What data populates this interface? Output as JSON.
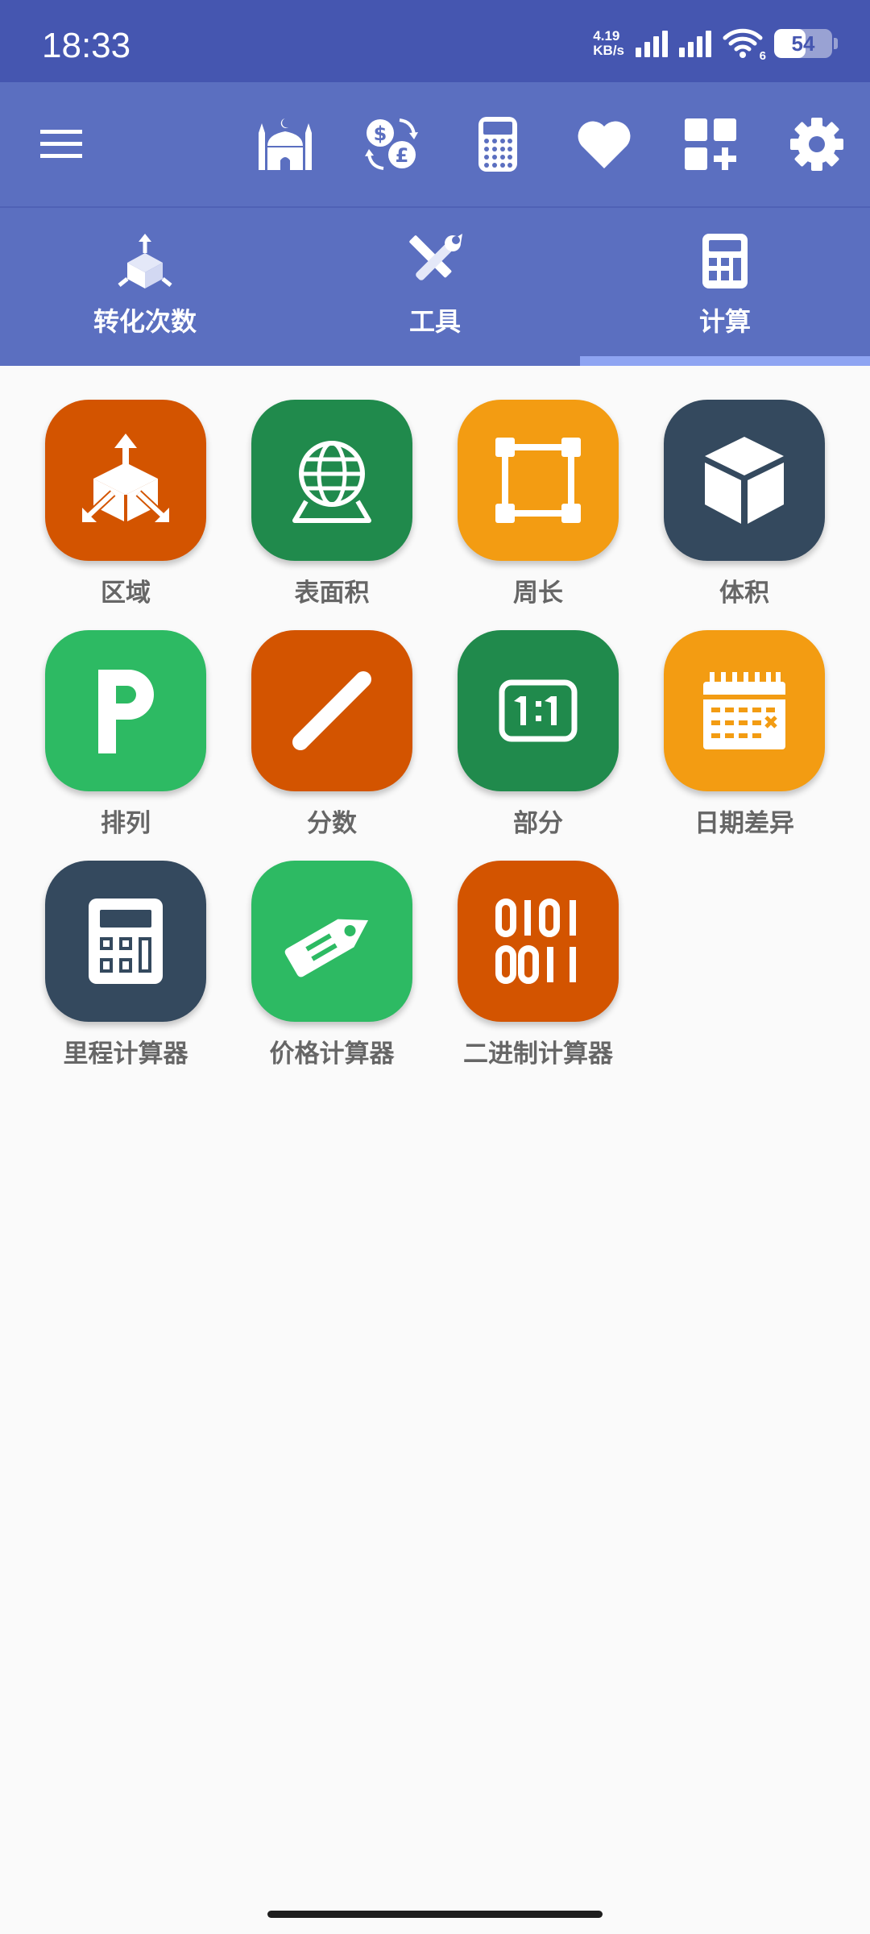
{
  "status_bar": {
    "time": "18:33",
    "net_speed_value": "4.19",
    "net_speed_unit": "KB/s",
    "wifi_badge": "6",
    "battery_level": "54",
    "battery_fraction": 0.54
  },
  "toolbar": {
    "icons": [
      "menu-icon",
      "mosque-icon",
      "currency-exchange-icon",
      "scientific-calculator-icon",
      "heart-icon",
      "add-widget-icon",
      "gear-icon"
    ]
  },
  "tabs": [
    {
      "label": "转化次数",
      "icon": "conversions-icon",
      "selected": false
    },
    {
      "label": "工具",
      "icon": "tools-icon",
      "selected": false
    },
    {
      "label": "计算",
      "icon": "calculator-icon",
      "selected": true
    }
  ],
  "grid": {
    "items": [
      {
        "label": "区域",
        "icon": "area-icon",
        "color": "#D35400"
      },
      {
        "label": "表面积",
        "icon": "globe-icon",
        "color": "#208A4C"
      },
      {
        "label": "周长",
        "icon": "perimeter-icon",
        "color": "#F39C12"
      },
      {
        "label": "体积",
        "icon": "cube-icon",
        "color": "#34495E"
      },
      {
        "label": "排列",
        "icon": "permutation-icon",
        "color": "#2DBA63"
      },
      {
        "label": "分数",
        "icon": "fraction-icon",
        "color": "#D35400"
      },
      {
        "label": "部分",
        "icon": "ratio-icon",
        "color": "#208A4C"
      },
      {
        "label": "日期差异",
        "icon": "calendar-icon",
        "color": "#F39C12"
      },
      {
        "label": "里程计算器",
        "icon": "calculator-icon",
        "color": "#34495E"
      },
      {
        "label": "价格计算器",
        "icon": "price-tag-icon",
        "color": "#2DBA63"
      },
      {
        "label": "二进制计算器",
        "icon": "binary-icon",
        "color": "#D35400"
      }
    ]
  }
}
